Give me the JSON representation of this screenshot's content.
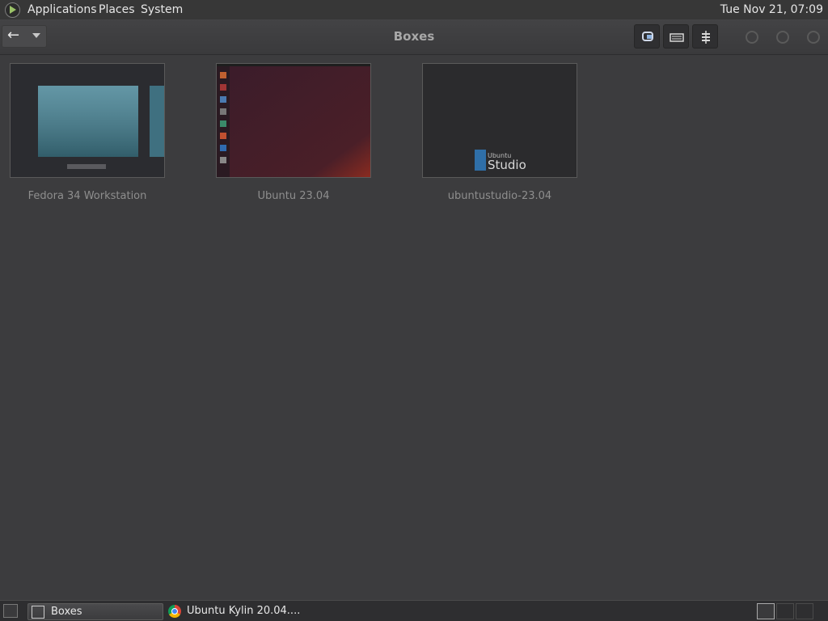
{
  "top_panel": {
    "menu": [
      "Applications",
      "Places",
      "System"
    ],
    "clock": "Tue Nov 21, 07:09"
  },
  "header": {
    "title": "Boxes",
    "icons": [
      "back-arrow-icon",
      "dropdown-arrow-icon",
      "display-icon",
      "keyboard-icon",
      "properties-icon"
    ]
  },
  "boxes": [
    {
      "name": "Fedora 34 Workstation"
    },
    {
      "name": "Ubuntu 23.04"
    },
    {
      "name": "ubuntustudio-23.04",
      "preview_brand_small": "Ubuntu",
      "preview_brand_large": "Studio"
    }
  ],
  "taskbar": {
    "tasks": [
      {
        "label": "Boxes",
        "icon": "boxes-icon",
        "active": true
      },
      {
        "label": "Ubuntu Kylin 20.04....",
        "icon": "chrome-icon",
        "active": false
      }
    ]
  },
  "colors": {
    "background": "#3c3c3e",
    "panel": "#373737",
    "label": "#8e8e8e"
  }
}
